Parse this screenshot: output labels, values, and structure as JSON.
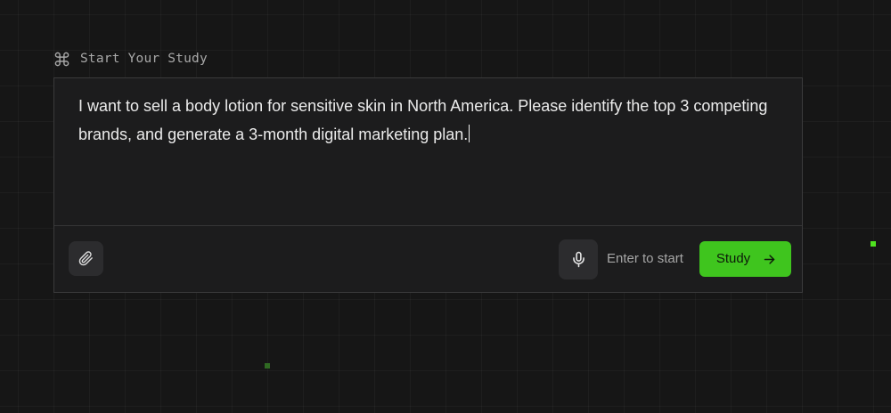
{
  "header": {
    "icon": "command-icon",
    "title": "Start Your Study"
  },
  "prompt": {
    "text": "I want to sell a body lotion for sensitive skin in North America. Please identify the top 3 competing brands, and generate a 3-month digital marketing plan."
  },
  "toolbar": {
    "attach_icon": "paperclip-icon",
    "mic_icon": "microphone-icon",
    "hint": "Enter to start",
    "submit_label": "Study",
    "submit_icon": "arrow-right-icon"
  },
  "colors": {
    "background": "#161616",
    "card": "#1c1c1d",
    "accent": "#3fc51e",
    "text": "#ececec",
    "muted": "#a6a6a6"
  }
}
